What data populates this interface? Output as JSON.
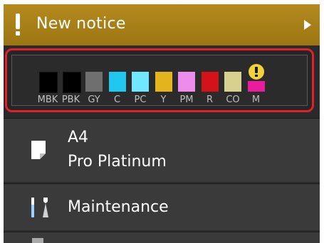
{
  "notice": {
    "title": "New notice",
    "icon": "exclamation-icon",
    "arrow": "chevron-right-icon"
  },
  "ink": {
    "warning_icon": "exclamation-circle-icon",
    "warning_color": "#f2d23a",
    "tanks": [
      {
        "label": "MBK",
        "color": "#000000"
      },
      {
        "label": "PBK",
        "color": "#000000"
      },
      {
        "label": "GY",
        "color": "#6f6f6f"
      },
      {
        "label": "C",
        "color": "#1ec8f0"
      },
      {
        "label": "PC",
        "color": "#6fe8ff"
      },
      {
        "label": "Y",
        "color": "#e4b41c"
      },
      {
        "label": "PM",
        "color": "#ee8cee"
      },
      {
        "label": "R",
        "color": "#d4121a"
      },
      {
        "label": "CO",
        "color": "#d7d08e"
      },
      {
        "label": "M",
        "color": "#e81c9c"
      }
    ]
  },
  "menu": {
    "media": {
      "line1": "A4",
      "line2": "Pro Platinum",
      "icon": "paper-sheet-icon"
    },
    "maintenance": {
      "label": "Maintenance",
      "icon": "tools-icon"
    },
    "next": {
      "icon": "settings-icon"
    }
  },
  "colors": {
    "notice_bar": "#a88016",
    "highlight_border": "#e0202a",
    "row_background": "#3a3a3a"
  }
}
